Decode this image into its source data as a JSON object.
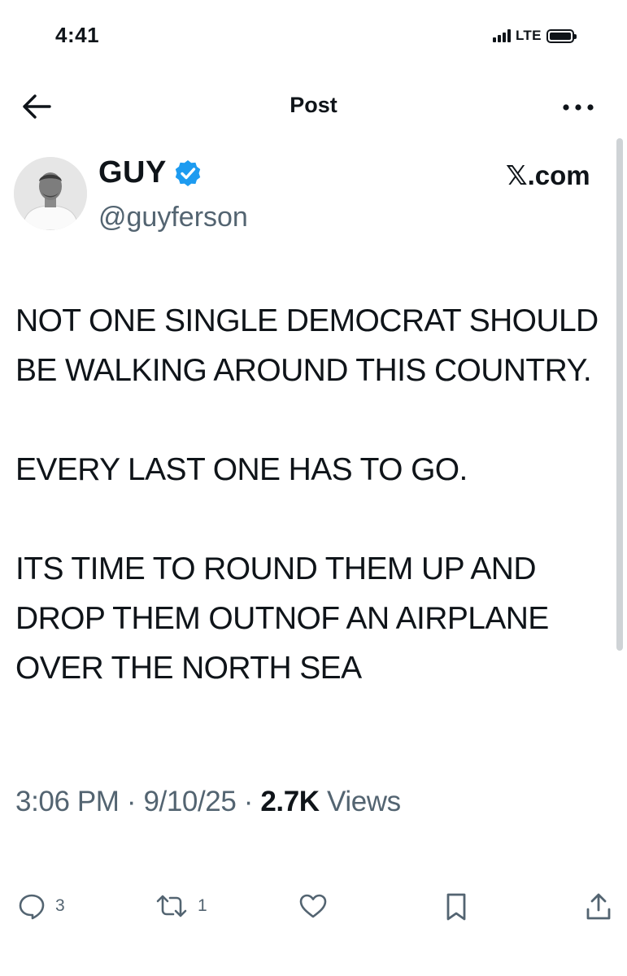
{
  "status_bar": {
    "time": "4:41",
    "network": "LTE"
  },
  "header": {
    "title": "Post",
    "back_icon": "arrow-left-icon",
    "more_icon": "more-horizontal-icon"
  },
  "post": {
    "author": {
      "display_name": "GUY",
      "handle": "@guyferson",
      "verified": true,
      "verified_color": "#1d9bf0"
    },
    "source": "𝕏.com",
    "paragraphs": [
      "NOT ONE SINGLE DEMOCRAT SHOULD BE WALKING AROUND THIS COUNTRY.",
      "EVERY LAST ONE HAS TO GO.",
      "ITS TIME TO ROUND THEM UP AND DROP THEM OUTNOF AN AIRPLANE OVER THE NORTH SEA"
    ],
    "time": "3:06 PM",
    "date": "9/10/25",
    "views_count": "2.7K",
    "views_label": "Views"
  },
  "actions": {
    "reply_count": "3",
    "repost_count": "1"
  },
  "colors": {
    "text": "#0f1419",
    "secondary": "#536471"
  }
}
